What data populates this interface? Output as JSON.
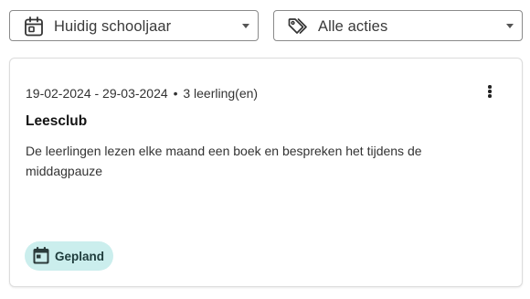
{
  "filters": {
    "period": {
      "value": "Huidig schooljaar",
      "icon": "calendar-icon"
    },
    "actions": {
      "value": "Alle acties",
      "icon": "tags-icon"
    }
  },
  "card": {
    "date_range": "19-02-2024 - 29-03-2024",
    "separator": "•",
    "participants": "3 leerling(en)",
    "title": "Leesclub",
    "description": "De leerlingen lezen elke maand een boek en bespreken het tijdens de middagpauze",
    "status": {
      "label": "Gepland",
      "icon": "calendar-event-icon",
      "color": "#cbeeed"
    }
  }
}
